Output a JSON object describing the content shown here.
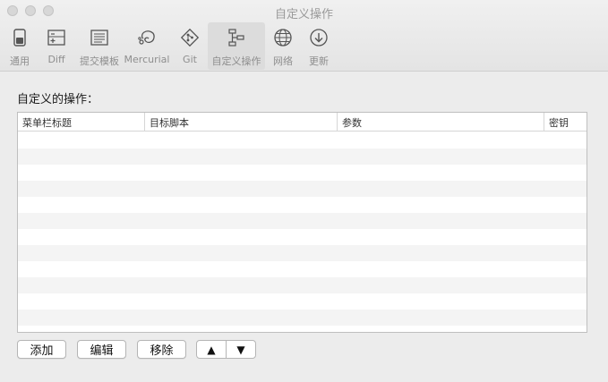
{
  "window": {
    "title": "自定义操作"
  },
  "toolbar": {
    "items": [
      {
        "label": "通用",
        "icon": "switch-icon"
      },
      {
        "label": "Diff",
        "icon": "diff-icon"
      },
      {
        "label": "提交模板",
        "icon": "document-icon"
      },
      {
        "label": "Mercurial",
        "icon": "mercurial-icon"
      },
      {
        "label": "Git",
        "icon": "git-icon"
      },
      {
        "label": "自定义操作",
        "icon": "custom-actions-icon",
        "active": true
      },
      {
        "label": "网络",
        "icon": "globe-icon"
      },
      {
        "label": "更新",
        "icon": "download-icon"
      }
    ]
  },
  "main": {
    "section_label": "自定义的操作：",
    "table": {
      "columns": [
        "菜单栏标题",
        "目标脚本",
        "参数",
        "密钥"
      ],
      "rows": []
    }
  },
  "buttons": {
    "add": "添加",
    "edit": "编辑",
    "remove": "移除",
    "move_up": "▲",
    "move_down": "▼"
  }
}
